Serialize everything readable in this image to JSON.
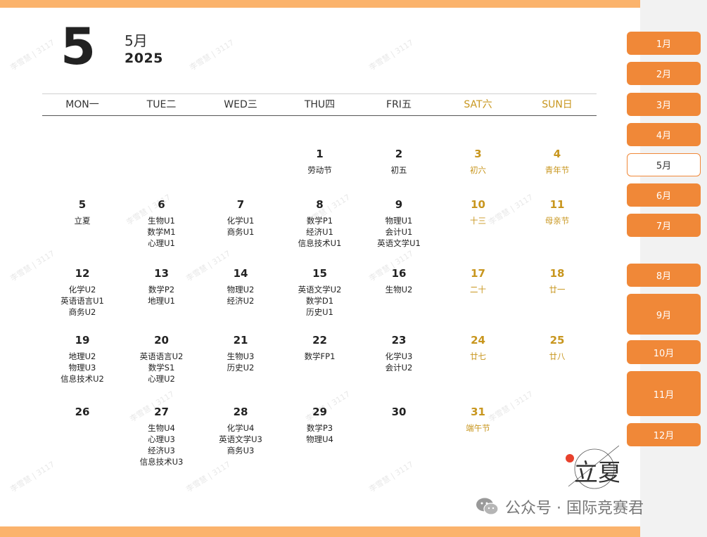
{
  "header": {
    "month_number": "5",
    "month_label": "5月",
    "year": "2025"
  },
  "weekdays": [
    {
      "label": "MON一",
      "weekend": false
    },
    {
      "label": "TUE二",
      "weekend": false
    },
    {
      "label": "WED三",
      "weekend": false
    },
    {
      "label": "THU四",
      "weekend": false
    },
    {
      "label": "FRI五",
      "weekend": false
    },
    {
      "label": "SAT六",
      "weekend": true
    },
    {
      "label": "SUN日",
      "weekend": true
    }
  ],
  "weeks": [
    [
      null,
      null,
      null,
      {
        "day": "1",
        "notes": [
          "劳动节"
        ]
      },
      {
        "day": "2",
        "notes": [
          "初五"
        ]
      },
      {
        "day": "3",
        "notes": [
          "初六"
        ]
      },
      {
        "day": "4",
        "notes": [
          "青年节"
        ]
      }
    ],
    [
      {
        "day": "5",
        "notes": [
          "立夏"
        ]
      },
      {
        "day": "6",
        "notes": [
          "生物U1",
          "数学M1",
          "心理U1"
        ]
      },
      {
        "day": "7",
        "notes": [
          "化学U1",
          "商务U1"
        ]
      },
      {
        "day": "8",
        "notes": [
          "数学P1",
          "经济U1",
          "信息技术U1"
        ]
      },
      {
        "day": "9",
        "notes": [
          "物理U1",
          "会计U1",
          "英语文学U1"
        ]
      },
      {
        "day": "10",
        "notes": [
          "十三"
        ]
      },
      {
        "day": "11",
        "notes": [
          "母亲节"
        ]
      }
    ],
    [
      {
        "day": "12",
        "notes": [
          "化学U2",
          "英语语言U1",
          "商务U2"
        ]
      },
      {
        "day": "13",
        "notes": [
          "数学P2",
          "地理U1"
        ]
      },
      {
        "day": "14",
        "notes": [
          "物理U2",
          "经济U2"
        ]
      },
      {
        "day": "15",
        "notes": [
          "英语文学U2",
          "数学D1",
          "历史U1"
        ]
      },
      {
        "day": "16",
        "notes": [
          "生物U2"
        ]
      },
      {
        "day": "17",
        "notes": [
          "二十"
        ]
      },
      {
        "day": "18",
        "notes": [
          "廿一"
        ]
      }
    ],
    [
      {
        "day": "19",
        "notes": [
          "地理U2",
          "物理U3",
          "信息技术U2"
        ]
      },
      {
        "day": "20",
        "notes": [
          "英语语言U2",
          "数学S1",
          "心理U2"
        ]
      },
      {
        "day": "21",
        "notes": [
          "生物U3",
          "历史U2"
        ]
      },
      {
        "day": "22",
        "notes": [
          "数学FP1"
        ]
      },
      {
        "day": "23",
        "notes": [
          "化学U3",
          "会计U2"
        ]
      },
      {
        "day": "24",
        "notes": [
          "廿七"
        ]
      },
      {
        "day": "25",
        "notes": [
          "廿八"
        ]
      }
    ],
    [
      {
        "day": "26",
        "notes": []
      },
      {
        "day": "27",
        "notes": [
          "生物U4",
          "心理U3",
          "经济U3",
          "信息技术U3"
        ]
      },
      {
        "day": "28",
        "notes": [
          "化学U4",
          "英语文学U3",
          "商务U3"
        ]
      },
      {
        "day": "29",
        "notes": [
          "数学P3",
          "物理U4"
        ]
      },
      {
        "day": "30",
        "notes": []
      },
      {
        "day": "31",
        "notes": [
          "端午节"
        ]
      },
      null
    ]
  ],
  "month_nav": [
    {
      "label": "1月",
      "active": false
    },
    {
      "label": "2月",
      "active": false
    },
    {
      "label": "3月",
      "active": false
    },
    {
      "label": "4月",
      "active": false
    },
    {
      "label": "5月",
      "active": true
    },
    {
      "label": "6月",
      "active": false
    },
    {
      "label": "7月",
      "active": false
    },
    {
      "label": "8月",
      "active": false
    },
    {
      "label": "9月",
      "active": false
    },
    {
      "label": "10月",
      "active": false
    },
    {
      "label": "11月",
      "active": false
    },
    {
      "label": "12月",
      "active": false
    }
  ],
  "seal_text": "立夏",
  "footer": {
    "credit": "公众号 · 国际竞赛君",
    "icon": "wechat-icon"
  },
  "watermark_text": "李雪慧 | 3117",
  "colors": {
    "accent": "#f08838",
    "bar": "#fbb36c",
    "weekend": "#c8961e",
    "seal_dot": "#e8412c"
  }
}
